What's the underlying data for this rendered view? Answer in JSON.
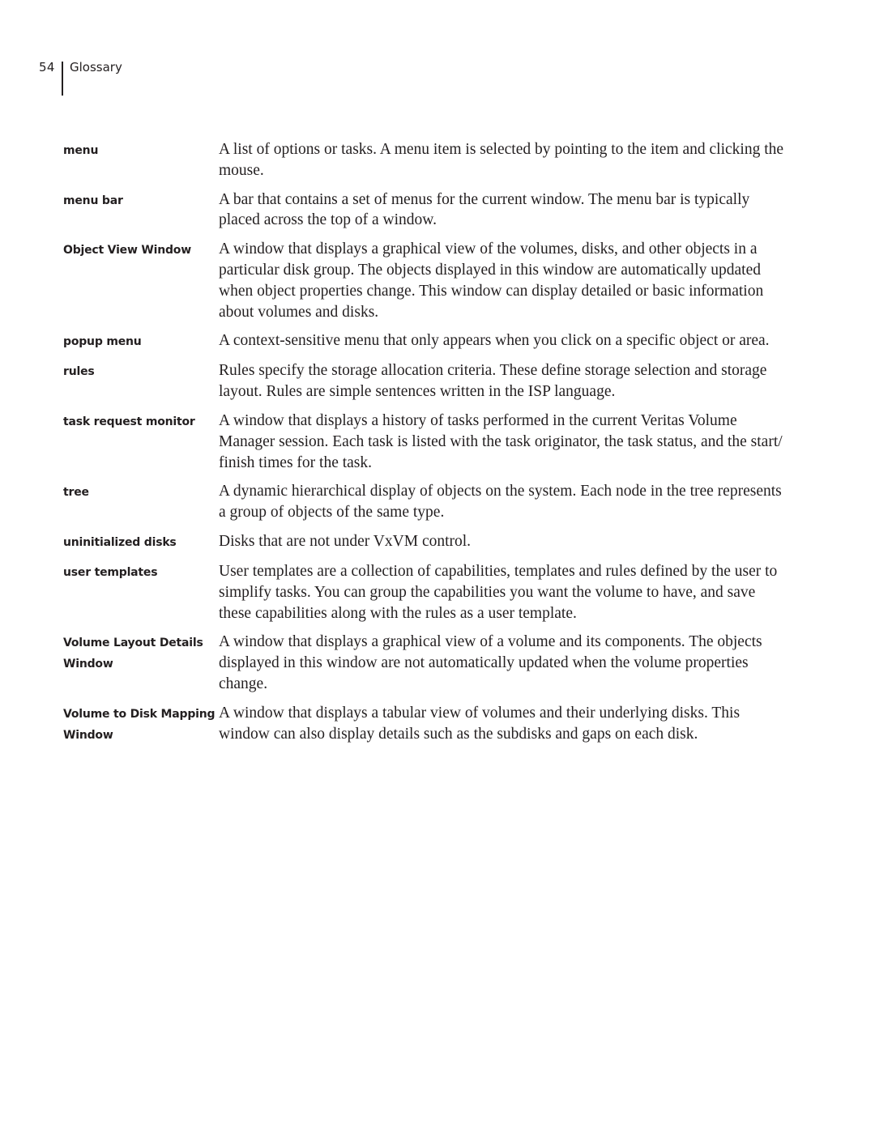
{
  "header": {
    "page_number": "54",
    "section_title": "Glossary"
  },
  "glossary": {
    "entries": [
      {
        "term": "menu",
        "definition": "A list of options or tasks. A menu item is selected by pointing to the item and clicking the mouse."
      },
      {
        "term": "menu bar",
        "definition": "A bar that contains a set of menus for the current window. The menu bar is typically placed across the top of a window."
      },
      {
        "term": "Object View Window",
        "definition": "A window that displays a graphical view of the volumes, disks, and other objects in a particular disk group. The objects displayed in this window are automatically updated when object properties change. This window can display detailed or basic information about volumes and disks."
      },
      {
        "term": "popup menu",
        "definition": "A context-sensitive menu that only appears when you click on a specific object or area."
      },
      {
        "term": "rules",
        "definition": "Rules specify the storage allocation criteria. These define storage selection and storage layout. Rules are simple sentences written in the ISP language."
      },
      {
        "term": "task request monitor",
        "definition": "A window that displays a history of tasks performed in the current Veritas Volume Manager session. Each task is listed with the task originator, the task status, and the start/ finish times for the task."
      },
      {
        "term": "tree",
        "definition": "A dynamic hierarchical display of objects on the system. Each node in the tree represents a group of objects of the same type."
      },
      {
        "term": "uninitialized disks",
        "definition": "Disks that are not under VxVM control."
      },
      {
        "term": "user templates",
        "definition": "User templates are a collection of capabilities, templates and rules defined by the user to simplify tasks. You can group the capabilities you want the volume to have, and save these capabilities along with the rules as a user template."
      },
      {
        "term": "Volume Layout Details Window",
        "definition": "A window that displays a graphical view of a volume and its components. The objects displayed in this window are not automatically updated when the volume properties change."
      },
      {
        "term": "Volume to Disk Mapping Window",
        "definition": "A window that displays a tabular view of volumes and their underlying disks. This window can also display details such as the subdisks and gaps on each disk."
      }
    ]
  }
}
